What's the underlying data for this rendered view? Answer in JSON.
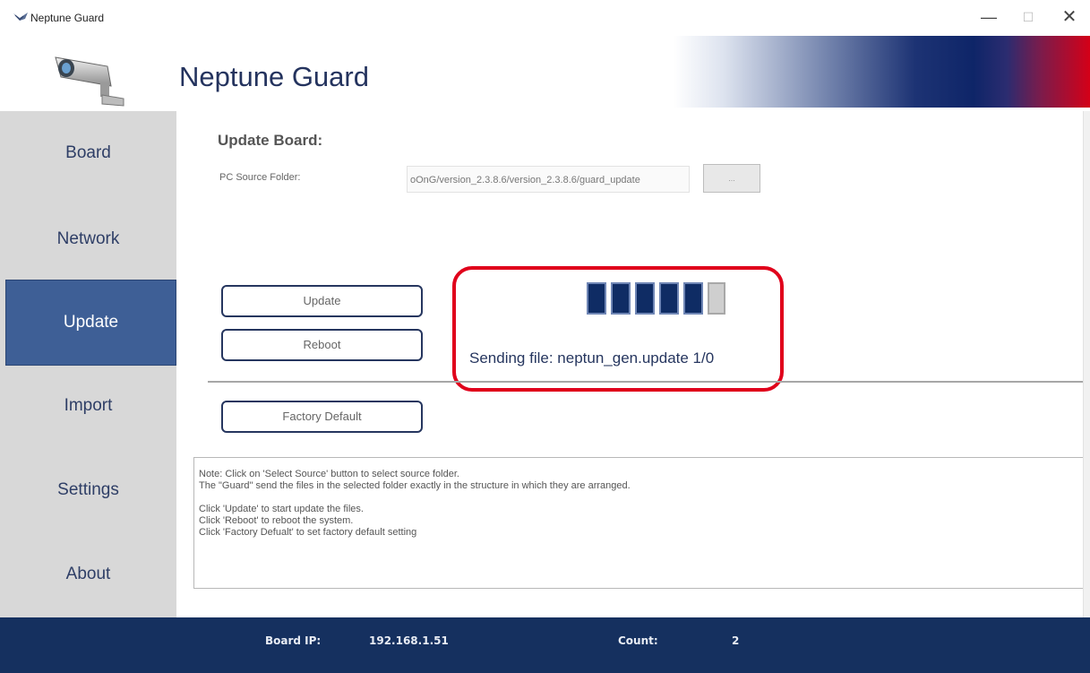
{
  "window": {
    "title": "Neptune Guard",
    "minimize": "—",
    "maximize": "☐",
    "close": "✕"
  },
  "header": {
    "title": "Neptune Guard",
    "logo_icon": "security-camera-icon"
  },
  "sidebar": {
    "items": [
      {
        "label": "Board"
      },
      {
        "label": "Network"
      },
      {
        "label": "Update",
        "active": true
      },
      {
        "label": "Import"
      },
      {
        "label": "Settings"
      },
      {
        "label": "About"
      }
    ]
  },
  "main": {
    "section_title": "Update Board:",
    "source_label": "PC Source Folder:",
    "source_path": "oOnG/version_2.3.8.6/version_2.3.8.6/guard_update",
    "browse_label": "...",
    "update_label": "Update",
    "reboot_label": "Reboot",
    "factory_label": "Factory Default",
    "progress": {
      "filled_blocks": 5,
      "total_blocks": 6,
      "status": "Sending file:  neptun_gen.update 1/0",
      "highlight_color": "#e0001b"
    },
    "notes": {
      "line1": "Note: Click on 'Select Source' button to select source folder.",
      "line2": "The \"Guard\" send the files in the selected folder exactly in the structure in which they are arranged.",
      "line3": "Click 'Update' to start update the files.",
      "line4": "Click 'Reboot' to reboot the system.",
      "line5": "Click 'Factory Defualt' to set factory default setting"
    }
  },
  "footer": {
    "ip_label": "Board IP:",
    "ip_value": "192.168.1.51",
    "count_label": "Count:",
    "count_value": "2"
  },
  "colors": {
    "sidebar_active": "#3e5f96",
    "footer_bg": "#15305f",
    "title_text": "#24335e"
  }
}
